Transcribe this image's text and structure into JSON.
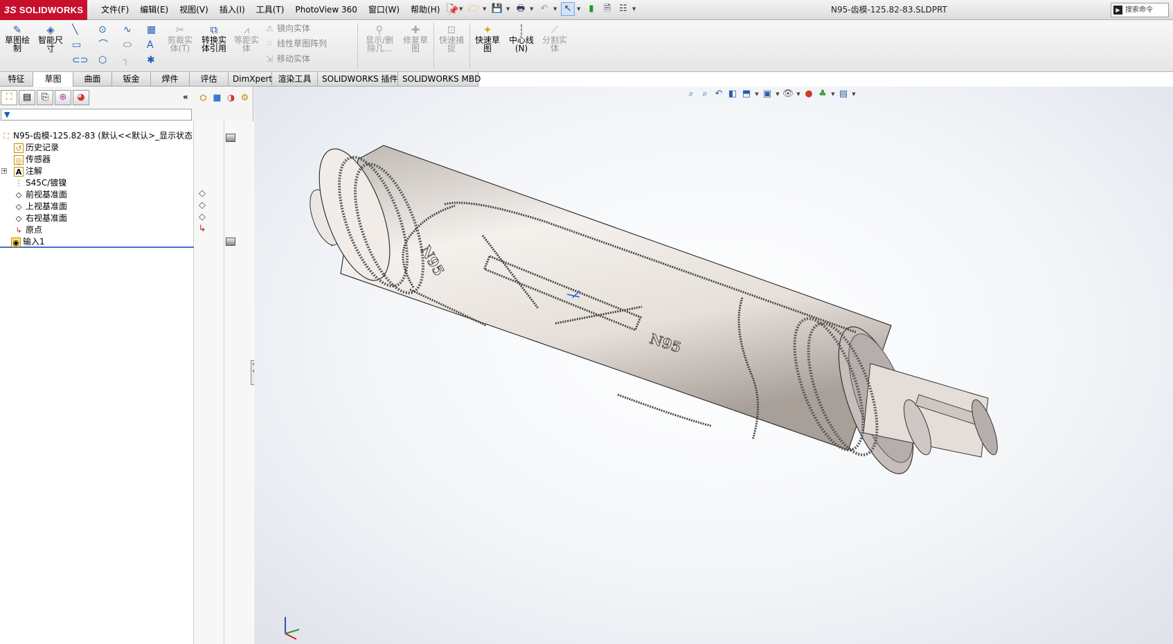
{
  "app": {
    "brand": "SOLIDWORKS",
    "brand_mark": "3S"
  },
  "menu": [
    "文件(F)",
    "编辑(E)",
    "视图(V)",
    "插入(I)",
    "工具(T)",
    "PhotoView 360",
    "窗口(W)",
    "帮助(H)"
  ],
  "document_title": "N95-齿模-125.82-83.SLDPRT",
  "search": {
    "placeholder": "搜索命令"
  },
  "ribbon": {
    "sketch": "草图绘\n制",
    "smart_dim": "智能尺\n寸",
    "trim": "剪裁实\n体(T)",
    "convert": "转换实\n体引用",
    "offset": "等距实\n体",
    "mirror": "镜向实体",
    "linear_pattern": "线性草图阵列",
    "move": "移动实体",
    "show_delete": "显示/删\n除几...",
    "repair": "修复草\n图",
    "quick_snap": "快速捕\n捉",
    "rapid_sketch": "快速草\n图",
    "centerline": "中心线\n(N)",
    "split": "分割实\n体"
  },
  "tabs": [
    "特征",
    "草图",
    "曲面",
    "钣金",
    "焊件",
    "评估",
    "DimXpert",
    "渲染工具",
    "SOLIDWORKS 插件",
    "SOLIDWORKS MBD"
  ],
  "active_tab": "草图",
  "tree": {
    "root": "N95-齿模-125.82-83  (默认<<默认>_显示状态 1>)",
    "items": [
      "历史记录",
      "传感器",
      "注解",
      "S45C/镀镍",
      "前视基准面",
      "上视基准面",
      "右视基准面",
      "原点",
      "输入1"
    ]
  },
  "part_text": [
    "N95",
    "N95"
  ],
  "colors": {
    "brand_red": "#c8102e",
    "part_body": "#e8e2dc",
    "accent_blue": "#2a5ca8"
  }
}
